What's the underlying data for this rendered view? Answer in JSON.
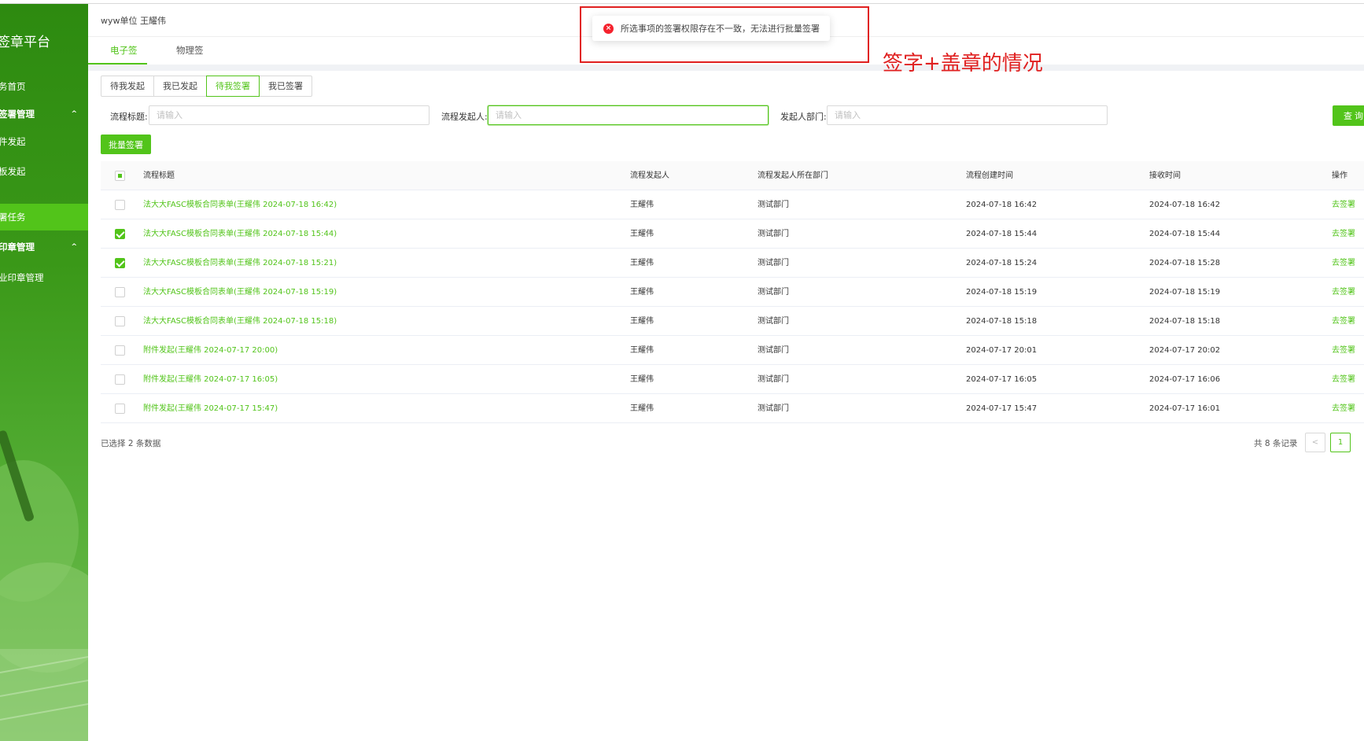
{
  "sidebar": {
    "brand": "签章平台",
    "items": [
      {
        "label": "务首页",
        "type": "item"
      },
      {
        "label": "签署管理",
        "type": "group",
        "caret": "^"
      },
      {
        "label": "件发起",
        "type": "item"
      },
      {
        "label": "板发起",
        "type": "item"
      },
      {
        "label": "署任务",
        "type": "item",
        "active": true
      },
      {
        "label": "印章管理",
        "type": "group",
        "caret": "^"
      },
      {
        "label": "业印章管理",
        "type": "item"
      }
    ]
  },
  "header": {
    "user": "wyw单位 王耀伟",
    "tabs": [
      {
        "label": "电子签",
        "active": true
      },
      {
        "label": "物理签",
        "active": false
      }
    ]
  },
  "toast": {
    "icon": "error-circle-icon",
    "message": "所选事项的签署权限存在不一致，无法进行批量签署"
  },
  "annotation": "签字+盖章的情况",
  "status_tabs": [
    {
      "label": "待我发起",
      "active": false
    },
    {
      "label": "我已发起",
      "active": false
    },
    {
      "label": "待我签署",
      "active": true
    },
    {
      "label": "我已签署",
      "active": false
    }
  ],
  "filters": {
    "title_label": "流程标题:",
    "title_placeholder": "请输入",
    "initiator_label": "流程发起人:",
    "initiator_placeholder": "请输入",
    "dept_label": "发起人部门:",
    "dept_placeholder": "请输入",
    "query_button": "查 询"
  },
  "batch_button": "批量签署",
  "table": {
    "columns": [
      "流程标题",
      "流程发起人",
      "流程发起人所在部门",
      "流程创建时间",
      "接收时间",
      "操作"
    ],
    "rows": [
      {
        "checked": false,
        "title": "法大大FASC模板合同表单(王耀伟 2024-07-18 16:42)",
        "initiator": "王耀伟",
        "dept": "测试部门",
        "created": "2024-07-18 16:42",
        "received": "2024-07-18 16:42",
        "action": "去签署"
      },
      {
        "checked": true,
        "title": "法大大FASC模板合同表单(王耀伟 2024-07-18 15:44)",
        "initiator": "王耀伟",
        "dept": "测试部门",
        "created": "2024-07-18 15:44",
        "received": "2024-07-18 15:44",
        "action": "去签署"
      },
      {
        "checked": true,
        "title": "法大大FASC模板合同表单(王耀伟 2024-07-18 15:21)",
        "initiator": "王耀伟",
        "dept": "测试部门",
        "created": "2024-07-18 15:24",
        "received": "2024-07-18 15:28",
        "action": "去签署"
      },
      {
        "checked": false,
        "title": "法大大FASC模板合同表单(王耀伟 2024-07-18 15:19)",
        "initiator": "王耀伟",
        "dept": "测试部门",
        "created": "2024-07-18 15:19",
        "received": "2024-07-18 15:19",
        "action": "去签署"
      },
      {
        "checked": false,
        "title": "法大大FASC模板合同表单(王耀伟 2024-07-18 15:18)",
        "initiator": "王耀伟",
        "dept": "测试部门",
        "created": "2024-07-18 15:18",
        "received": "2024-07-18 15:18",
        "action": "去签署"
      },
      {
        "checked": false,
        "title": "附件发起(王耀伟 2024-07-17 20:00)",
        "initiator": "王耀伟",
        "dept": "测试部门",
        "created": "2024-07-17 20:01",
        "received": "2024-07-17 20:02",
        "action": "去签署"
      },
      {
        "checked": false,
        "title": "附件发起(王耀伟 2024-07-17 16:05)",
        "initiator": "王耀伟",
        "dept": "测试部门",
        "created": "2024-07-17 16:05",
        "received": "2024-07-17 16:06",
        "action": "去签署"
      },
      {
        "checked": false,
        "title": "附件发起(王耀伟 2024-07-17 15:47)",
        "initiator": "王耀伟",
        "dept": "测试部门",
        "created": "2024-07-17 15:47",
        "received": "2024-07-17 16:01",
        "action": "去签署"
      }
    ]
  },
  "footer": {
    "selected_info": "已选择 2 条数据",
    "total": "共 8 条记录",
    "prev": "<",
    "current_page": "1"
  },
  "colors": {
    "primary": "#52c41a",
    "sidebar": "#2d8a10",
    "error": "#f5222d",
    "annotation": "#e02020"
  }
}
